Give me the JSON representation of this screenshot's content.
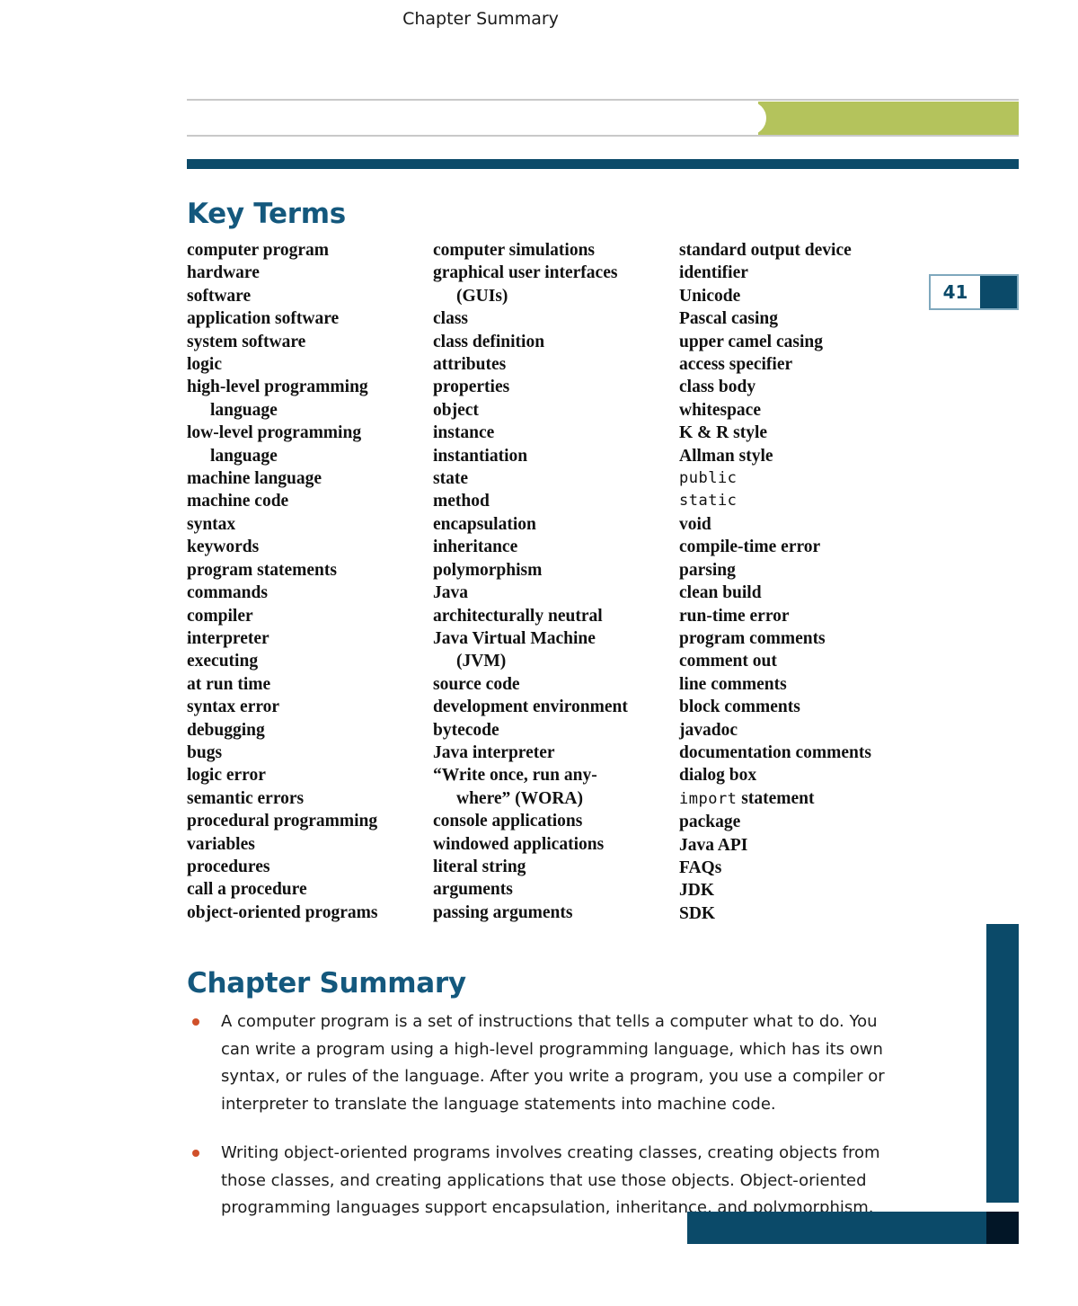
{
  "header": {
    "tab_label": "Chapter Summary",
    "green_color": "#b4c35c",
    "navy_color": "#0b4a69"
  },
  "page_number": "41",
  "key_terms": {
    "heading": "Key Terms",
    "columns": [
      [
        {
          "text": "computer program",
          "indent": false,
          "code": false
        },
        {
          "text": "hardware",
          "indent": false,
          "code": false
        },
        {
          "text": "software",
          "indent": false,
          "code": false
        },
        {
          "text": "application software",
          "indent": false,
          "code": false
        },
        {
          "text": "system software",
          "indent": false,
          "code": false
        },
        {
          "text": "logic",
          "indent": false,
          "code": false
        },
        {
          "text": "high-level programming",
          "indent": false,
          "code": false
        },
        {
          "text": "language",
          "indent": true,
          "code": false
        },
        {
          "text": "low-level programming",
          "indent": false,
          "code": false
        },
        {
          "text": "language",
          "indent": true,
          "code": false
        },
        {
          "text": "machine language",
          "indent": false,
          "code": false
        },
        {
          "text": "machine code",
          "indent": false,
          "code": false
        },
        {
          "text": "syntax",
          "indent": false,
          "code": false
        },
        {
          "text": "keywords",
          "indent": false,
          "code": false
        },
        {
          "text": "program statements",
          "indent": false,
          "code": false
        },
        {
          "text": "commands",
          "indent": false,
          "code": false
        },
        {
          "text": "compiler",
          "indent": false,
          "code": false
        },
        {
          "text": "interpreter",
          "indent": false,
          "code": false
        },
        {
          "text": "executing",
          "indent": false,
          "code": false
        },
        {
          "text": "at run time",
          "indent": false,
          "code": false
        },
        {
          "text": "syntax error",
          "indent": false,
          "code": false
        },
        {
          "text": "debugging",
          "indent": false,
          "code": false
        },
        {
          "text": "bugs",
          "indent": false,
          "code": false
        },
        {
          "text": "logic error",
          "indent": false,
          "code": false
        },
        {
          "text": "semantic errors",
          "indent": false,
          "code": false
        },
        {
          "text": "procedural programming",
          "indent": false,
          "code": false
        },
        {
          "text": "variables",
          "indent": false,
          "code": false
        },
        {
          "text": "procedures",
          "indent": false,
          "code": false
        },
        {
          "text": "call a procedure",
          "indent": false,
          "code": false
        },
        {
          "text": "object-oriented programs",
          "indent": false,
          "code": false
        }
      ],
      [
        {
          "text": "computer simulations",
          "indent": false,
          "code": false
        },
        {
          "text": "graphical user interfaces",
          "indent": false,
          "code": false
        },
        {
          "text": "(GUIs)",
          "indent": true,
          "code": false
        },
        {
          "text": "class",
          "indent": false,
          "code": false
        },
        {
          "text": "class definition",
          "indent": false,
          "code": false
        },
        {
          "text": "attributes",
          "indent": false,
          "code": false
        },
        {
          "text": "properties",
          "indent": false,
          "code": false
        },
        {
          "text": "object",
          "indent": false,
          "code": false
        },
        {
          "text": "instance",
          "indent": false,
          "code": false
        },
        {
          "text": "instantiation",
          "indent": false,
          "code": false
        },
        {
          "text": "state",
          "indent": false,
          "code": false
        },
        {
          "text": "method",
          "indent": false,
          "code": false
        },
        {
          "text": "encapsulation",
          "indent": false,
          "code": false
        },
        {
          "text": "inheritance",
          "indent": false,
          "code": false
        },
        {
          "text": "polymorphism",
          "indent": false,
          "code": false
        },
        {
          "text": "Java",
          "indent": false,
          "code": false
        },
        {
          "text": "architecturally neutral",
          "indent": false,
          "code": false
        },
        {
          "text": "Java Virtual Machine",
          "indent": false,
          "code": false
        },
        {
          "text": "(JVM)",
          "indent": true,
          "code": false
        },
        {
          "text": "source code",
          "indent": false,
          "code": false
        },
        {
          "text": "development environment",
          "indent": false,
          "code": false
        },
        {
          "text": "bytecode",
          "indent": false,
          "code": false
        },
        {
          "text": "Java interpreter",
          "indent": false,
          "code": false
        },
        {
          "text": "“Write once, run any-",
          "indent": false,
          "code": false
        },
        {
          "text": "where” (WORA)",
          "indent": true,
          "code": false
        },
        {
          "text": "console applications",
          "indent": false,
          "code": false
        },
        {
          "text": "windowed applications",
          "indent": false,
          "code": false
        },
        {
          "text": "literal string",
          "indent": false,
          "code": false
        },
        {
          "text": "arguments",
          "indent": false,
          "code": false
        },
        {
          "text": "passing arguments",
          "indent": false,
          "code": false
        }
      ],
      [
        {
          "text": "standard output device",
          "indent": false,
          "code": false
        },
        {
          "text": "identifier",
          "indent": false,
          "code": false
        },
        {
          "text": "Unicode",
          "indent": false,
          "code": false
        },
        {
          "text": "Pascal casing",
          "indent": false,
          "code": false
        },
        {
          "text": "upper camel casing",
          "indent": false,
          "code": false
        },
        {
          "text": "access specifier",
          "indent": false,
          "code": false
        },
        {
          "text": "class body",
          "indent": false,
          "code": false
        },
        {
          "text": "whitespace",
          "indent": false,
          "code": false
        },
        {
          "text": "K & R style",
          "indent": false,
          "code": false
        },
        {
          "text": "Allman style",
          "indent": false,
          "code": false
        },
        {
          "text": "public",
          "indent": false,
          "code": true
        },
        {
          "text": "static",
          "indent": false,
          "code": true
        },
        {
          "text": "void",
          "indent": false,
          "code": false
        },
        {
          "text": "compile-time error",
          "indent": false,
          "code": false
        },
        {
          "text": "parsing",
          "indent": false,
          "code": false
        },
        {
          "text": "clean build",
          "indent": false,
          "code": false
        },
        {
          "text": "run-time error",
          "indent": false,
          "code": false
        },
        {
          "text": "program comments",
          "indent": false,
          "code": false
        },
        {
          "text": "comment out",
          "indent": false,
          "code": false
        },
        {
          "text": "line comments",
          "indent": false,
          "code": false
        },
        {
          "text": "block comments",
          "indent": false,
          "code": false
        },
        {
          "text": "javadoc",
          "indent": false,
          "code": false
        },
        {
          "text": "documentation comments",
          "indent": false,
          "code": false
        },
        {
          "text": "dialog box",
          "indent": false,
          "code": false
        },
        {
          "text": "import statement",
          "indent": false,
          "code": false,
          "code_prefix": "import",
          "code_suffix": " statement"
        },
        {
          "text": "package",
          "indent": false,
          "code": false
        },
        {
          "text": "Java API",
          "indent": false,
          "code": false
        },
        {
          "text": "FAQs",
          "indent": false,
          "code": false
        },
        {
          "text": "JDK",
          "indent": false,
          "code": false
        },
        {
          "text": "SDK",
          "indent": false,
          "code": false
        }
      ]
    ]
  },
  "chapter_summary": {
    "heading": "Chapter Summary",
    "bullets": [
      "A computer program is a set of instructions that tells a computer what to do. You can write a program using a high-level programming language, which has its own syntax, or rules of the language. After you write a program, you use a compiler or interpreter to translate the language statements into machine code.",
      "Writing object-oriented programs involves creating classes, creating objects from those classes, and creating applications that use those objects. Object-oriented programming languages support encapsulation, inheritance, and polymorphism."
    ],
    "bullet_color": "#d0502a"
  }
}
